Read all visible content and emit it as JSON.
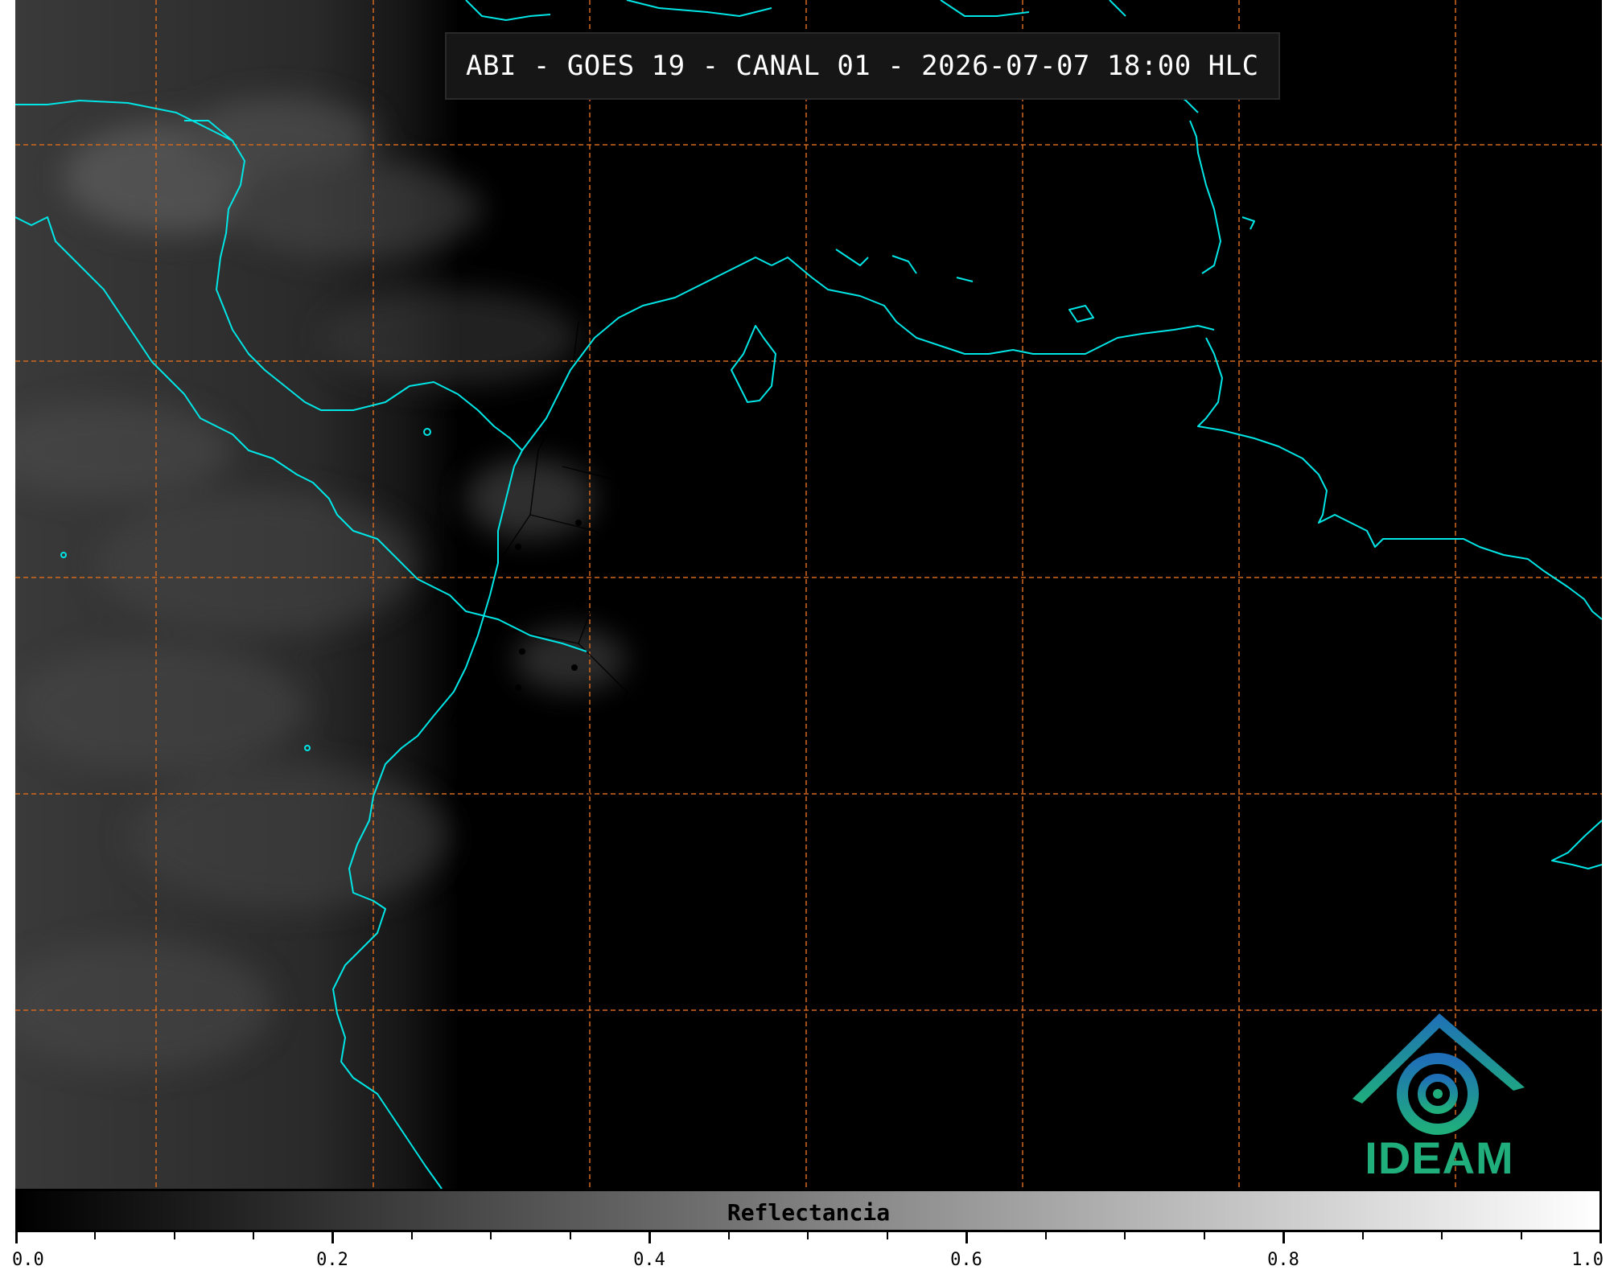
{
  "header": {
    "title": "ABI - GOES 19 - CANAL 01 - 2026-07-07 18:00 HLC"
  },
  "colorbar": {
    "label": "Reflectancia",
    "ticks": [
      "0.0",
      "0.2",
      "0.4",
      "0.6",
      "0.8",
      "1.0"
    ],
    "range": [
      0.0,
      1.0
    ]
  },
  "logo": {
    "text": "IDEAM",
    "icon": "ideam-logo-icon"
  },
  "colors": {
    "coastline": "#00e5e5",
    "gridline": "#d2691e",
    "logo_text": "#1fae7c",
    "logo_mark": "#1f7fae",
    "background": "#000000"
  }
}
